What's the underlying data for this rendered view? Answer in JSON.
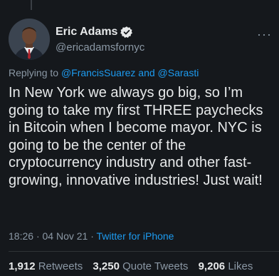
{
  "author": {
    "display_name": "Eric Adams",
    "handle": "@ericadamsfornyc",
    "verified": true
  },
  "menu": {
    "more_label": "···"
  },
  "reply_context": {
    "prefix": "Replying to",
    "mention_1": "@FrancisSuarez",
    "joiner": "and",
    "mention_2": "@Sarasti"
  },
  "tweet": {
    "text": "In New York we always go big, so I’m going to take my first THREE paychecks in Bitcoin when I become mayor. NYC is going to be the center of the cryptocurrency industry and other fast-growing, innovative industries! Just wait!",
    "time": "18:26",
    "separator": "·",
    "date": "04 Nov 21",
    "separator2": "·",
    "source": "Twitter for iPhone"
  },
  "stats": {
    "retweets_count": "1,912",
    "retweets_label": "Retweets",
    "quotes_count": "3,250",
    "quotes_label": "Quote Tweets",
    "likes_count": "9,206",
    "likes_label": "Likes"
  },
  "colors": {
    "background": "#15181c",
    "text": "#e7e9ea",
    "muted": "#8b98a5",
    "accent": "#1d9bf0"
  }
}
